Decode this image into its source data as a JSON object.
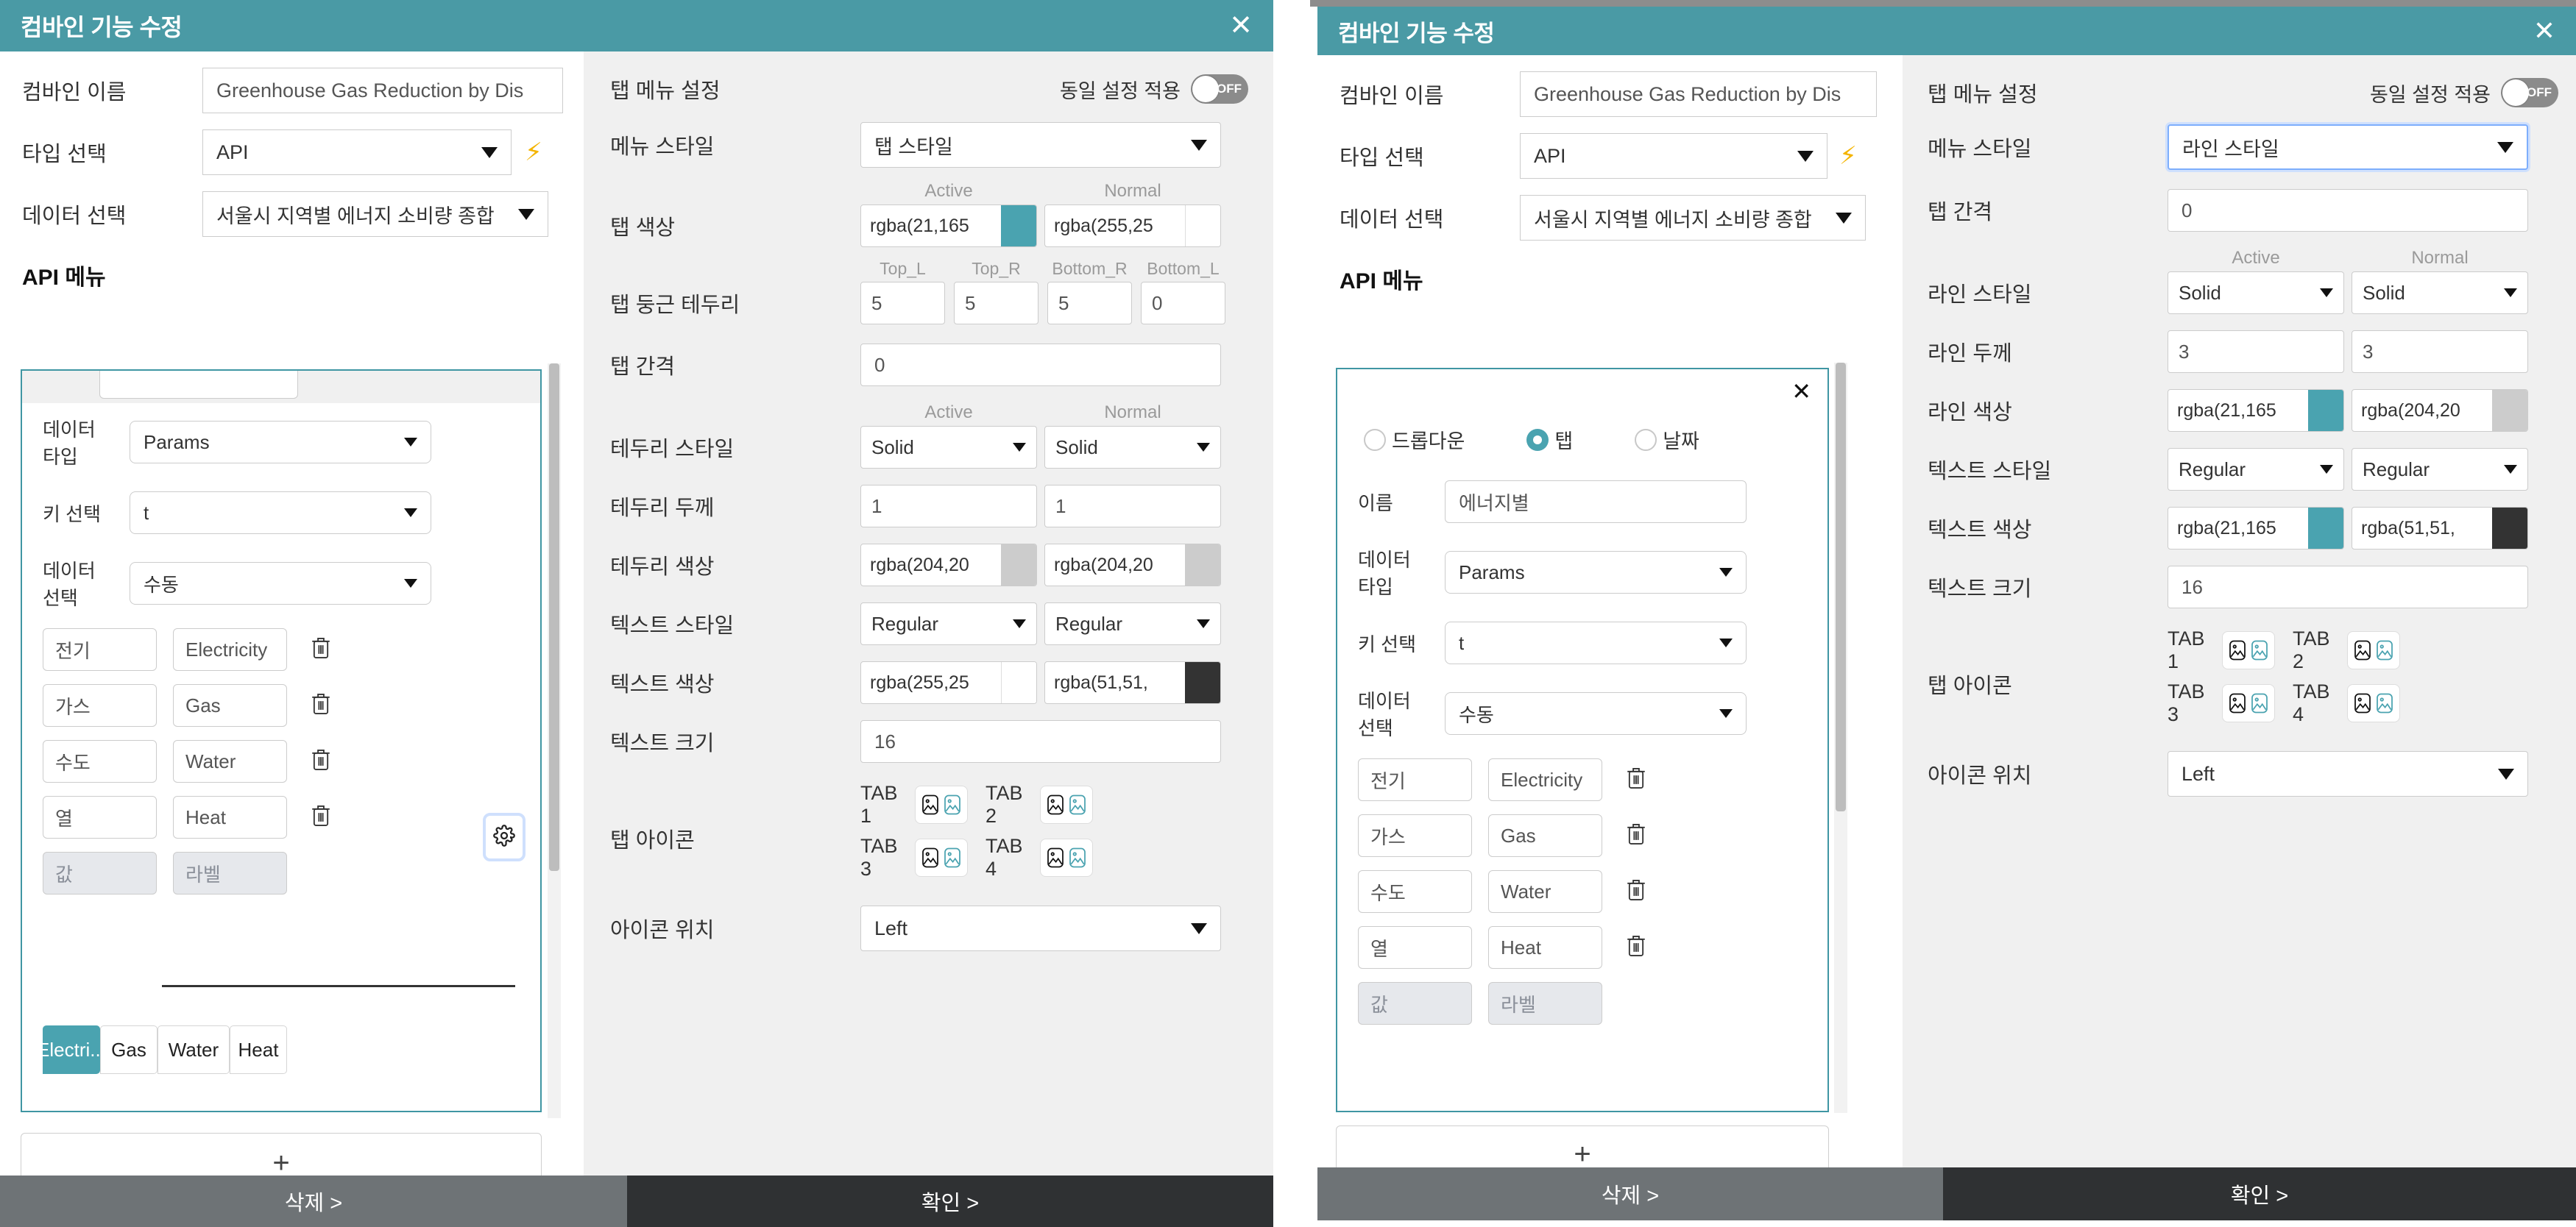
{
  "left_window": {
    "title": "컴바인 기능 수정",
    "close_icon": "close-icon",
    "form": {
      "name_label": "컴바인 이름",
      "name_value": "Greenhouse Gas Reduction by Dis",
      "type_label": "타입 선택",
      "type_value": "API",
      "bolt_icon": "lightning-bolt-icon",
      "data_label": "데이터 선택",
      "data_value": "서울시 지역별 에너지 소비량 종합",
      "api_menu_label": "API 메뉴"
    },
    "api_card": {
      "datatype_label": "데이터 타입",
      "datatype_value": "Params",
      "key_label": "키 선택",
      "key_value": "t",
      "dataselect_label": "데이터 선택",
      "dataselect_value": "수동",
      "pairs": [
        {
          "key": "전기",
          "label": "Electricity",
          "delete_icon": "trash-icon"
        },
        {
          "key": "가스",
          "label": "Gas",
          "delete_icon": "trash-icon"
        },
        {
          "key": "수도",
          "label": "Water",
          "delete_icon": "trash-icon"
        },
        {
          "key": "열",
          "label": "Heat",
          "delete_icon": "trash-icon"
        }
      ],
      "new_key_placeholder": "값",
      "new_label_placeholder": "라벨",
      "gear_icon": "gear-icon",
      "preview_tabs": [
        {
          "label": "Electri...",
          "active": true
        },
        {
          "label": "Gas",
          "active": false
        },
        {
          "label": "Water",
          "active": false
        },
        {
          "label": "Heat",
          "active": false
        }
      ]
    },
    "add_button": "+",
    "settings": {
      "section_title": "탭 메뉴 설정",
      "same_setting_label": "동일 설정 적용",
      "toggle_state": "OFF",
      "menu_style_label": "메뉴 스타일",
      "menu_style_value": "탭 스타일",
      "col_active": "Active",
      "col_normal": "Normal",
      "tab_color_label": "탭 색상",
      "tab_color_active": "rgba(21,165",
      "tab_color_active_swatch": "#4aa3b0",
      "tab_color_normal": "rgba(255,25",
      "tab_color_normal_swatch": "#ffffff",
      "radius_label": "탭 둥근 테두리",
      "radius_cols": [
        "Top_L",
        "Top_R",
        "Bottom_R",
        "Bottom_L"
      ],
      "radius_values": [
        "5",
        "5",
        "5",
        "0"
      ],
      "tab_gap_label": "탭 간격",
      "tab_gap_value": "0",
      "border_style_label": "테두리 스타일",
      "border_style_active": "Solid",
      "border_style_normal": "Solid",
      "border_width_label": "테두리 두께",
      "border_width_active": "1",
      "border_width_normal": "1",
      "border_color_label": "테두리 색상",
      "border_color_active": "rgba(204,20",
      "border_color_active_swatch": "#cccccc",
      "border_color_normal": "rgba(204,20",
      "border_color_normal_swatch": "#cccccc",
      "text_style_label": "텍스트 스타일",
      "text_style_active": "Regular",
      "text_style_normal": "Regular",
      "text_color_label": "텍스트 색상",
      "text_color_active": "rgba(255,25",
      "text_color_active_swatch": "#ffffff",
      "text_color_normal": "rgba(51,51,",
      "text_color_normal_swatch": "#333333",
      "text_size_label": "텍스트 크기",
      "text_size_value": "16",
      "tab_icon_label": "탭 아이콘",
      "tab_icons": [
        {
          "name": "TAB 1",
          "icon_a": "image-icon",
          "icon_b": "image-icon-teal"
        },
        {
          "name": "TAB 2",
          "icon_a": "image-icon",
          "icon_b": "image-icon-teal"
        },
        {
          "name": "TAB 3",
          "icon_a": "image-icon",
          "icon_b": "image-icon-teal"
        },
        {
          "name": "TAB 4",
          "icon_a": "image-icon",
          "icon_b": "image-icon-teal"
        }
      ],
      "icon_pos_label": "아이콘 위치",
      "icon_pos_value": "Left"
    },
    "footer": {
      "delete": "삭제 >",
      "confirm": "확인 >"
    }
  },
  "right_window": {
    "title": "컴바인 기능 수정",
    "close_icon": "close-icon",
    "form": {
      "name_label": "컴바인 이름",
      "name_value": "Greenhouse Gas Reduction by Dis",
      "type_label": "타입 선택",
      "type_value": "API",
      "bolt_icon": "lightning-bolt-icon",
      "data_label": "데이터 선택",
      "data_value": "서울시 지역별 에너지 소비량 종합",
      "api_menu_label": "API 메뉴"
    },
    "api_card": {
      "close_icon": "close-icon",
      "radios": [
        {
          "label": "드롭다운",
          "selected": false
        },
        {
          "label": "탭",
          "selected": true
        },
        {
          "label": "날짜",
          "selected": false
        }
      ],
      "name_label": "이름",
      "name_value": "에너지별",
      "datatype_label": "데이터 타입",
      "datatype_value": "Params",
      "key_label": "키 선택",
      "key_value": "t",
      "dataselect_label": "데이터 선택",
      "dataselect_value": "수동",
      "pairs": [
        {
          "key": "전기",
          "label": "Electricity",
          "delete_icon": "trash-icon"
        },
        {
          "key": "가스",
          "label": "Gas",
          "delete_icon": "trash-icon"
        },
        {
          "key": "수도",
          "label": "Water",
          "delete_icon": "trash-icon"
        },
        {
          "key": "열",
          "label": "Heat",
          "delete_icon": "trash-icon"
        }
      ],
      "new_key_placeholder": "값",
      "new_label_placeholder": "라벨"
    },
    "add_button": "+",
    "settings": {
      "section_title": "탭 메뉴 설정",
      "same_setting_label": "동일 설정 적용",
      "toggle_state": "OFF",
      "menu_style_label": "메뉴 스타일",
      "menu_style_value": "라인 스타일",
      "tab_gap_label": "탭 간격",
      "tab_gap_value": "0",
      "col_active": "Active",
      "col_normal": "Normal",
      "line_style_label": "라인 스타일",
      "line_style_active": "Solid",
      "line_style_normal": "Solid",
      "line_width_label": "라인 두께",
      "line_width_active": "3",
      "line_width_normal": "3",
      "line_color_label": "라인 색상",
      "line_color_active": "rgba(21,165",
      "line_color_active_swatch": "#4aa3b0",
      "line_color_normal": "rgba(204,20",
      "line_color_normal_swatch": "#cccccc",
      "text_style_label": "텍스트 스타일",
      "text_style_active": "Regular",
      "text_style_normal": "Regular",
      "text_color_label": "텍스트 색상",
      "text_color_active": "rgba(21,165",
      "text_color_active_swatch": "#4aa3b0",
      "text_color_normal": "rgba(51,51,",
      "text_color_normal_swatch": "#333333",
      "text_size_label": "텍스트 크기",
      "text_size_value": "16",
      "tab_icon_label": "탭 아이콘",
      "tab_icons": [
        {
          "name": "TAB 1",
          "icon_a": "image-icon",
          "icon_b": "image-icon-teal"
        },
        {
          "name": "TAB 2",
          "icon_a": "image-icon",
          "icon_b": "image-icon-teal"
        },
        {
          "name": "TAB 3",
          "icon_a": "image-icon",
          "icon_b": "image-icon-teal"
        },
        {
          "name": "TAB 4",
          "icon_a": "image-icon",
          "icon_b": "image-icon-teal"
        }
      ],
      "icon_pos_label": "아이콘 위치",
      "icon_pos_value": "Left"
    },
    "footer": {
      "delete": "삭제 >",
      "confirm": "확인 >"
    }
  },
  "theme": {
    "accent": "#4a9aa5",
    "accent_tab": "#4aa3b0",
    "footer_delete": "#6e7376",
    "footer_ok": "#2f3133",
    "panel_bg": "#f0f0f0",
    "border": "#cccccc"
  }
}
